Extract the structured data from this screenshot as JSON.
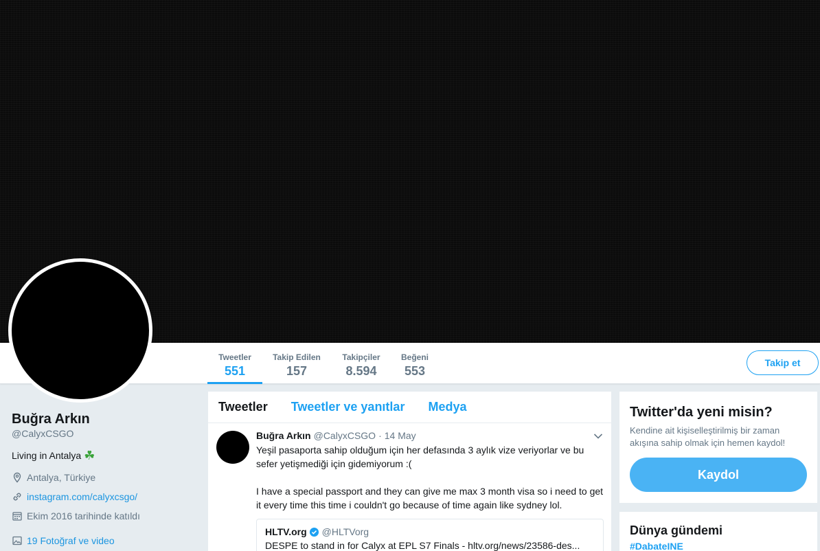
{
  "profile": {
    "name": "Buğra Arkın",
    "handle": "@CalyxCSGO",
    "bio": "Living in Antalya",
    "bio_emoji": "☘",
    "location": "Antalya, Türkiye",
    "website": "instagram.com/calyxcsgo/",
    "joined": "Ekim 2016 tarihinde katıldı",
    "photos": "19 Fotoğraf ve video"
  },
  "stats": [
    {
      "label": "Tweetler",
      "value": "551"
    },
    {
      "label": "Takip Edilen",
      "value": "157"
    },
    {
      "label": "Takipçiler",
      "value": "8.594"
    },
    {
      "label": "Beğeni",
      "value": "553"
    }
  ],
  "follow_button": "Takip et",
  "tabs": [
    "Tweetler",
    "Tweetler ve yanıtlar",
    "Medya"
  ],
  "tweet": {
    "author": "Buğra Arkın",
    "handle": "@CalyxCSGO",
    "separator": "·",
    "time": "14 May",
    "text_tr": "Yeşil pasaporta sahip olduğum için her defasında 3 aylık vize veriyorlar ve bu sefer yetişmediği için gidemiyorum :(",
    "text_en": "I have a special passport and they can give me max 3 month visa so i need to get it every time this time i couldn't go because of time again like sydney lol.",
    "quote": {
      "name": "HLTV.org",
      "handle": "@HLTVorg",
      "text": "DESPE to stand in for Calyx at EPL S7 Finals - hltv.org/news/23586-des..."
    }
  },
  "signup": {
    "title": "Twitter'da yeni misin?",
    "subtitle": "Kendine ait kişiselleştirilmiş bir zaman akışına sahip olmak için hemen kaydol!",
    "button": "Kaydol"
  },
  "trends": {
    "title": "Dünya gündemi",
    "first": "#DabateINE"
  },
  "colors": {
    "accent": "#1da1f2",
    "signup_button": "#4ab3f4",
    "background": "#e6ecf0",
    "secondary_text": "#657786"
  },
  "icons": {
    "location": "map-pin-icon",
    "website": "link-icon",
    "joined": "calendar-icon",
    "photos": "image-icon",
    "caret": "chevron-down-icon",
    "verified": "verified-badge-icon",
    "bio_emoji": "clover-icon"
  }
}
